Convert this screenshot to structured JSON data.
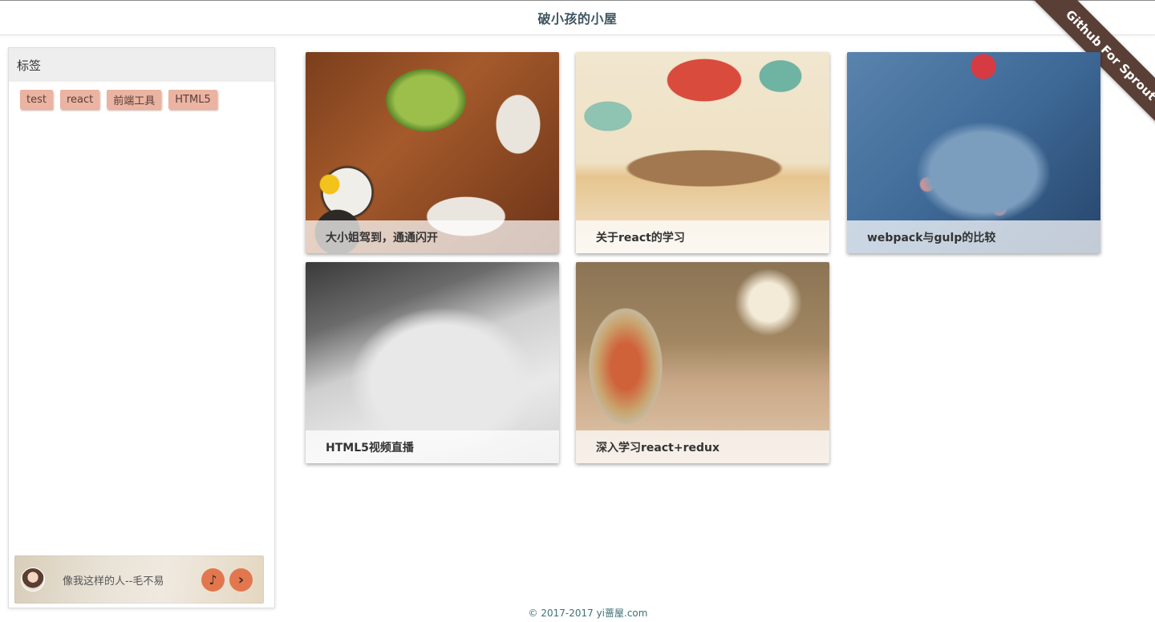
{
  "header": {
    "title": "破小孩的小屋"
  },
  "ribbon": {
    "label": "Github For Sprout"
  },
  "sidebar": {
    "heading": "标签",
    "tags": [
      "test",
      "react",
      "前端工具",
      "HTML5"
    ]
  },
  "player": {
    "song": "像我这样的人--毛不易",
    "music_icon": "♪",
    "next_icon": "›"
  },
  "posts": [
    {
      "title": "大小姐驾到，通通闪开"
    },
    {
      "title": "关于react的学习"
    },
    {
      "title": "webpack与gulp的比较"
    },
    {
      "title": "HTML5视频直播"
    },
    {
      "title": "深入学习react+redux"
    }
  ],
  "footer": {
    "copyright": "© 2017-2017 yi蔷屋.com"
  },
  "colors": {
    "tag_bg": "#eab3a2",
    "ribbon_bg": "#5a3f37",
    "player_button": "#e2774f"
  }
}
